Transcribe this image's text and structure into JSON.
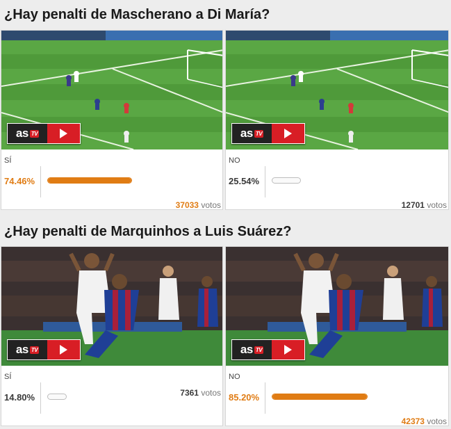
{
  "colors": {
    "accent": "#e07c14",
    "muted": "#3a3a3a",
    "brand_red": "#d81e25"
  },
  "polls": [
    {
      "title": "¿Hay penalti de Mascherano a Di María?",
      "options": [
        {
          "label": "SÍ",
          "percent_text": "74.46%",
          "percent": 74.46,
          "votes": "37033",
          "votes_unit": "votos",
          "leading": true
        },
        {
          "label": "NO",
          "percent_text": "25.54%",
          "percent": 25.54,
          "votes": "12701",
          "votes_unit": "votos",
          "leading": false
        }
      ]
    },
    {
      "title": "¿Hay penalti de Marquinhos a Luis Suárez?",
      "options": [
        {
          "label": "SÍ",
          "percent_text": "14.80%",
          "percent": 14.8,
          "votes": "7361",
          "votes_unit": "votos",
          "leading": false
        },
        {
          "label": "NO",
          "percent_text": "85.20%",
          "percent": 85.2,
          "votes": "42373",
          "votes_unit": "votos",
          "leading": true
        }
      ]
    }
  ],
  "video_badge": {
    "logo": "as",
    "tv": "TV",
    "icon": "play-icon"
  }
}
